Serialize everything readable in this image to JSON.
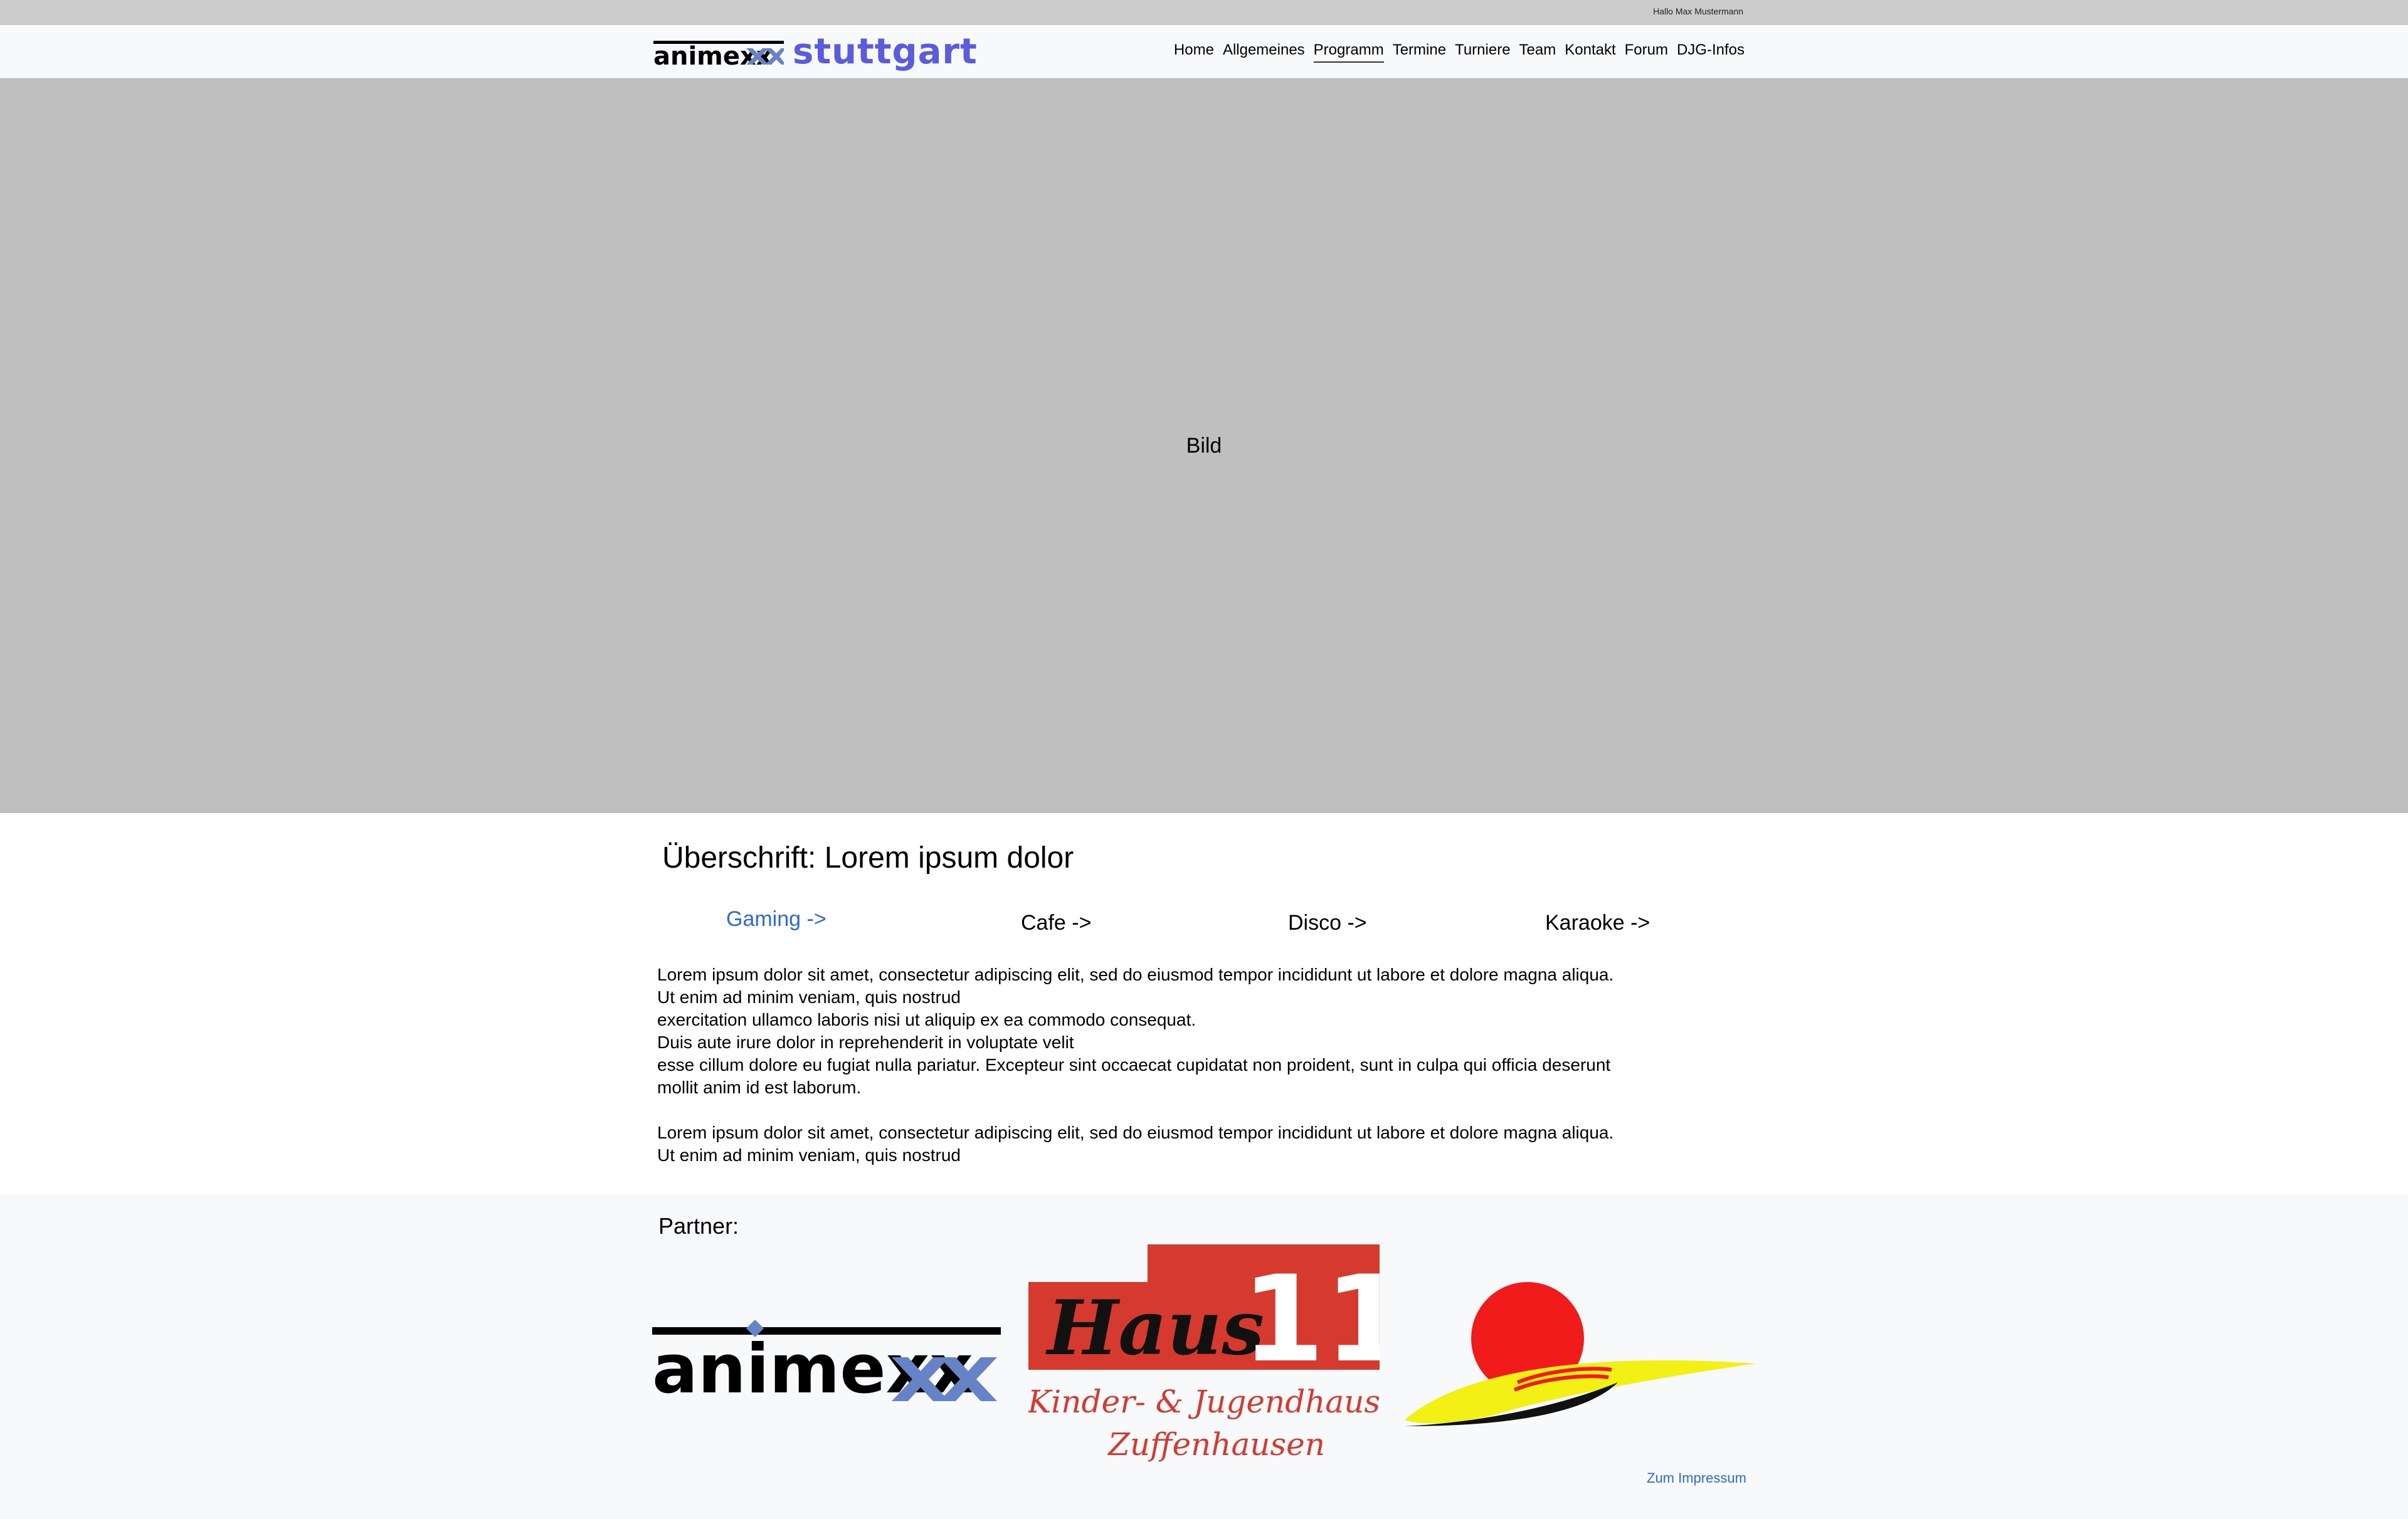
{
  "topbar": {
    "greeting": "Hallo Max Mustermann"
  },
  "header": {
    "brand_logo": "animexx",
    "brand_city": "stuttgart",
    "nav": [
      {
        "label": "Home",
        "active": false
      },
      {
        "label": "Allgemeines",
        "active": false
      },
      {
        "label": "Programm",
        "active": true
      },
      {
        "label": "Termine",
        "active": false
      },
      {
        "label": "Turniere",
        "active": false
      },
      {
        "label": "Team",
        "active": false
      },
      {
        "label": "Kontakt",
        "active": false
      },
      {
        "label": "Forum",
        "active": false
      },
      {
        "label": "DJG-Infos",
        "active": false
      }
    ]
  },
  "hero": {
    "label": "Bild",
    "background": "#bfbfbf"
  },
  "main": {
    "heading": "Überschrift: Lorem ipsum dolor",
    "categories": [
      {
        "label": "Gaming ->",
        "link": true
      },
      {
        "label": "Cafe ->",
        "link": false
      },
      {
        "label": "Disco ->",
        "link": false
      },
      {
        "label": "Karaoke ->",
        "link": false
      }
    ],
    "paragraphs": [
      "Lorem ipsum dolor sit amet, consectetur adipiscing elit, sed do eiusmod tempor incididunt ut labore et dolore magna aliqua.\nUt enim ad minim veniam, quis nostrud\nexercitation ullamco laboris nisi ut aliquip ex ea commodo consequat.\nDuis aute irure dolor in reprehenderit in voluptate velit\nesse cillum dolore eu fugiat nulla pariatur. Excepteur sint occaecat cupidatat non proident, sunt in culpa qui officia deserunt\nmollit anim id est laborum.",
      "Lorem ipsum dolor sit amet, consectetur adipiscing elit, sed do eiusmod tempor incididunt ut labore et dolore magna aliqua.\nUt enim ad minim veniam, quis nostrud"
    ]
  },
  "footer": {
    "partner_label": "Partner:",
    "partners": [
      {
        "name": "animexx"
      },
      {
        "name": "Haus 11",
        "haus_word": "Haus",
        "haus_number": "11",
        "line1": "Kinder- & Jugendhaus",
        "line2": "Zuffenhausen"
      },
      {
        "name": "sun-logo"
      }
    ],
    "impressum": "Zum Impressum"
  },
  "colors": {
    "accent_blue": "#5b5be0",
    "link_blue": "#2a6ad9",
    "haus_red": "#d63a2f",
    "sun_red": "#f11b1b",
    "sun_yellow": "#f3f016",
    "animexx_x": "#6683c8"
  }
}
